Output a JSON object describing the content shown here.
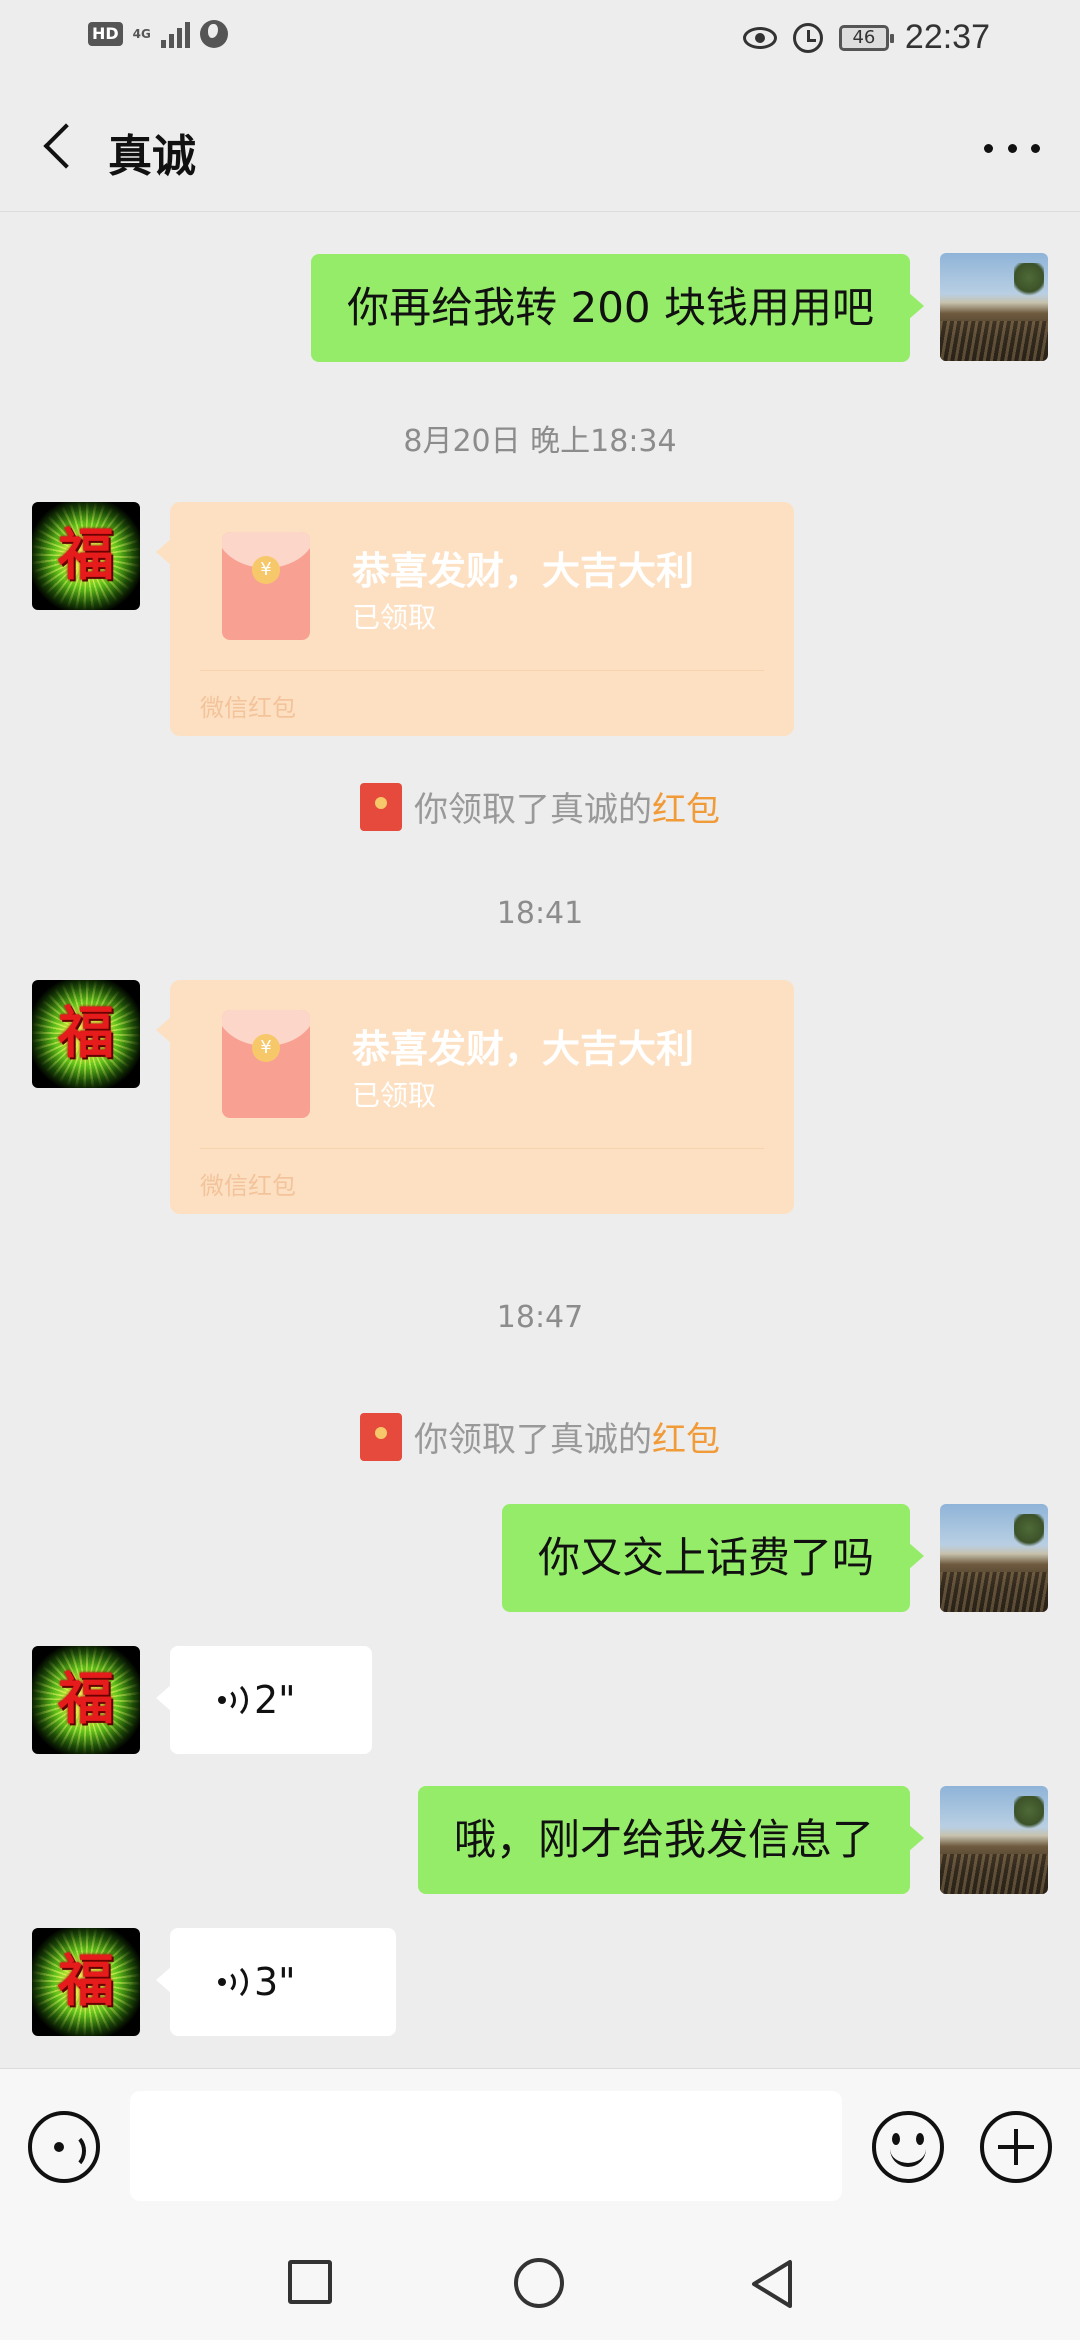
{
  "status_bar": {
    "hd": "HD",
    "network": "4G",
    "battery": "46",
    "time": "22:37"
  },
  "header": {
    "title": "真诚"
  },
  "messages": {
    "m1": {
      "text": "你再给我转 200 块钱用用吧"
    },
    "ts1": "8月20日 晚上18:34",
    "rp1": {
      "title": "恭喜发财，大吉大利",
      "status": "已领取",
      "brand": "微信红包"
    },
    "sys1": {
      "prefix": "你领取了真诚的",
      "link": "红包"
    },
    "ts2": "18:41",
    "rp2": {
      "title": "恭喜发财，大吉大利",
      "status": "已领取",
      "brand": "微信红包"
    },
    "ts3": "18:47",
    "sys2": {
      "prefix": "你领取了真诚的",
      "link": "红包"
    },
    "m2": {
      "text": "你又交上话费了吗"
    },
    "v1": {
      "duration": "2\""
    },
    "m3": {
      "text": "哦，刚才给我发信息了"
    },
    "v2": {
      "duration": "3\""
    }
  },
  "avatar_glyph": "福",
  "coin_glyph": "¥",
  "input": {
    "placeholder": ""
  }
}
